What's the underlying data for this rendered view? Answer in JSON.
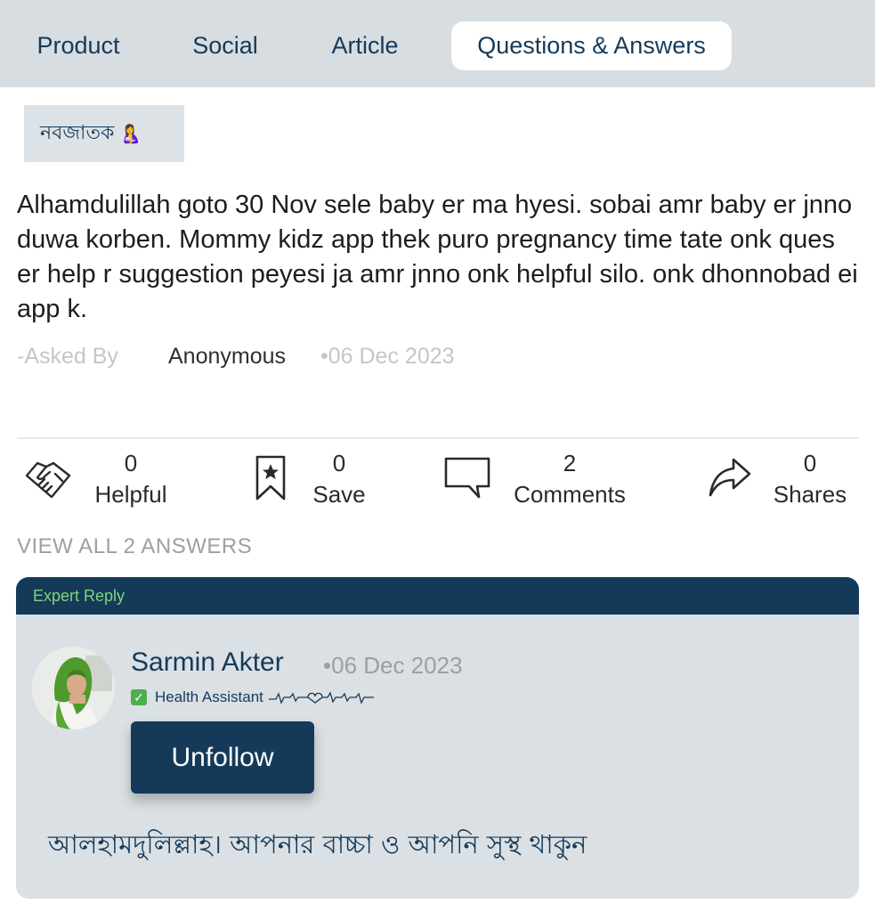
{
  "tabs": [
    {
      "label": "Product",
      "active": false
    },
    {
      "label": "Social",
      "active": false
    },
    {
      "label": "Article",
      "active": false
    },
    {
      "label": "Questions & Answers",
      "active": true
    }
  ],
  "tag": {
    "label": "নবজাতক",
    "emoji": "🤱"
  },
  "question": {
    "text": "Alhamdulillah goto 30 Nov sele baby er ma hyesi. sobai amr baby er jnno duwa korben. Mommy kidz app thek puro pregnancy time tate onk ques er help r suggestion peyesi ja amr jnno onk helpful silo. onk dhonnobad ei app k.",
    "asked_by_label": "-Asked By",
    "author": "Anonymous",
    "date": "•06 Dec 2023"
  },
  "stats": {
    "helpful": {
      "count": "0",
      "label": "Helpful",
      "icon": "handshake-icon"
    },
    "save": {
      "count": "0",
      "label": "Save",
      "icon": "bookmark-star-icon"
    },
    "comments": {
      "count": "2",
      "label": "Comments",
      "icon": "speech-bubble-icon"
    },
    "shares": {
      "count": "0",
      "label": "Shares",
      "icon": "share-arrow-icon"
    }
  },
  "view_all": "VIEW ALL 2 ANSWERS",
  "reply": {
    "header": "Expert Reply",
    "name": "Sarmin Akter",
    "date": "•06 Dec 2023",
    "role": "Health Assistant",
    "verified_icon": "check-box-icon",
    "follow_button": "Unfollow",
    "text": "আলহামদুলিল্লাহ। আপনার বাচ্চা ও আপনি সুস্থ থাকুন",
    "colors": {
      "header_bg": "#153a59",
      "header_text": "#7fd67a",
      "card_bg": "#dbe0e4"
    }
  },
  "colors": {
    "accent": "#153a59",
    "tabbar_bg": "#d7dde1",
    "muted": "#c3c7ca"
  }
}
